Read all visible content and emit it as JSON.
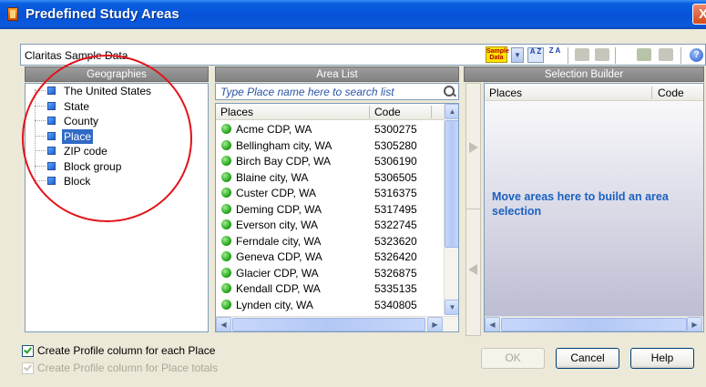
{
  "window": {
    "title": "Predefined Study Areas",
    "close_label": "X"
  },
  "toolbar": {
    "source_label": "Claritas Sample Data",
    "sample_data_label": "Sample Data",
    "sort_az_label": "A Z",
    "sort_za_label": "Z A",
    "help_label": "?"
  },
  "geographies": {
    "header": "Geographies",
    "items": [
      {
        "label": "The United States"
      },
      {
        "label": "State"
      },
      {
        "label": "County"
      },
      {
        "label": "Place",
        "selected": true
      },
      {
        "label": "ZIP code"
      },
      {
        "label": "Block group"
      },
      {
        "label": "Block"
      }
    ]
  },
  "area_list": {
    "header": "Area List",
    "search_placeholder": "Type Place name here to search list",
    "col_places": "Places",
    "col_code": "Code",
    "rows": [
      {
        "name": "Acme CDP, WA",
        "code": "5300275"
      },
      {
        "name": "Bellingham city, WA",
        "code": "5305280"
      },
      {
        "name": "Birch Bay CDP, WA",
        "code": "5306190"
      },
      {
        "name": "Blaine city, WA",
        "code": "5306505"
      },
      {
        "name": "Custer CDP, WA",
        "code": "5316375"
      },
      {
        "name": "Deming CDP, WA",
        "code": "5317495"
      },
      {
        "name": "Everson city, WA",
        "code": "5322745"
      },
      {
        "name": "Ferndale city, WA",
        "code": "5323620"
      },
      {
        "name": "Geneva CDP, WA",
        "code": "5326420"
      },
      {
        "name": "Glacier CDP, WA",
        "code": "5326875"
      },
      {
        "name": "Kendall CDP, WA",
        "code": "5335135"
      },
      {
        "name": "Lynden city, WA",
        "code": "5340805"
      }
    ]
  },
  "selection_builder": {
    "header": "Selection Builder",
    "col_places": "Places",
    "col_code": "Code",
    "message": "Move areas here to build an area selection"
  },
  "options": {
    "profile_each_label": "Create Profile column for each Place",
    "profile_each_checked": true,
    "profile_totals_label": "Create Profile column for Place totals",
    "profile_totals_checked": true
  },
  "buttons": {
    "ok": "OK",
    "cancel": "Cancel",
    "help": "Help"
  }
}
